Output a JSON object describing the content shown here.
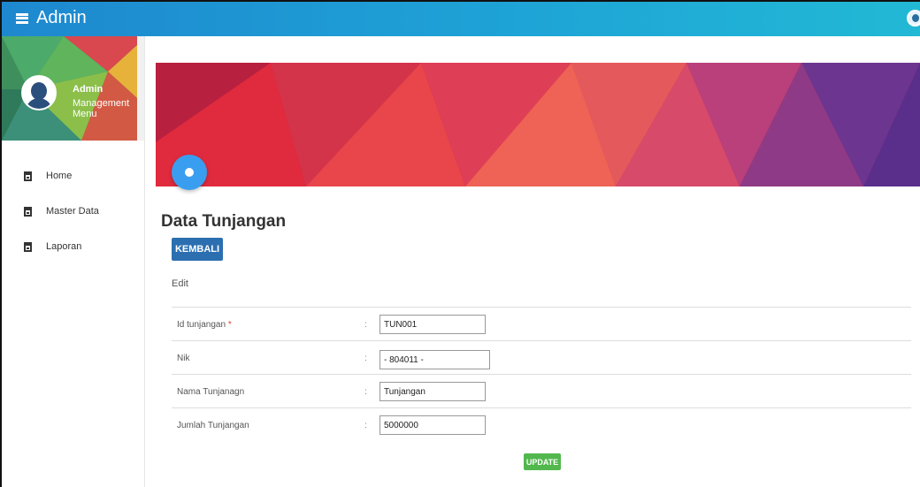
{
  "header": {
    "title": "Admin",
    "menu_icon": "hamburger-icon",
    "avatar_icon": "user-avatar-icon"
  },
  "sidebar": {
    "profile_name": "Admin",
    "profile_subtitle": "Management Menu",
    "items": [
      {
        "label": "Home",
        "icon": "clipboard-icon"
      },
      {
        "label": "Master Data",
        "icon": "clipboard-icon"
      },
      {
        "label": "Laporan",
        "icon": "clipboard-icon"
      }
    ]
  },
  "main": {
    "page_title": "Data Tunjangan",
    "back_button": "KEMBALI",
    "section_label": "Edit",
    "fields": [
      {
        "label": "Id tunjangan",
        "required_mark": "*",
        "value": "TUN001"
      },
      {
        "label": "Nik",
        "value": "- 804011 -"
      },
      {
        "label": "Nama Tunjanagn",
        "value": "Tunjangan"
      },
      {
        "label": "Jumlah Tunjangan",
        "value": "5000000"
      }
    ],
    "colon": ":",
    "update_button": "UPDATE"
  },
  "colors": {
    "header_start": "#1e88cf",
    "header_end": "#22b9d5",
    "back_button": "#2c6fb0",
    "update_button": "#52b84d",
    "fab": "#3a9ef0"
  }
}
